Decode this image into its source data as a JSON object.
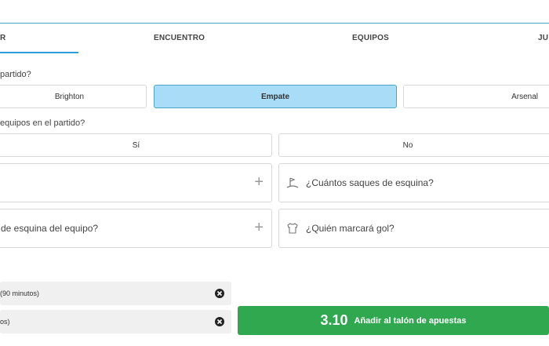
{
  "tabs": [
    {
      "label": "R"
    },
    {
      "label": "ENCUENTRO"
    },
    {
      "label": "EQUIPOS"
    },
    {
      "label": "JU"
    }
  ],
  "question1": {
    "label": "partido?",
    "options": [
      "Brighton",
      "Empate",
      "Arsenal"
    ],
    "selected": "Empate"
  },
  "question2": {
    "label": "equipos en el partido?",
    "options": [
      "Sí",
      "No"
    ]
  },
  "cards": [
    {
      "text": ""
    },
    {
      "text": "¿Cuántos saques de esquina?"
    },
    {
      "text": "de esquina del equipo?"
    },
    {
      "text": "¿Quién marcará gol?"
    }
  ],
  "selections": [
    {
      "text": "(90 minutos)"
    },
    {
      "text": "os)"
    }
  ],
  "cta": {
    "odds": "3.10",
    "label": "Añadir al talón de apuestas"
  },
  "colors": {
    "accent": "#2a9fd8",
    "selected_bg": "#a9ddf7",
    "cta_green": "#2fa84f"
  }
}
